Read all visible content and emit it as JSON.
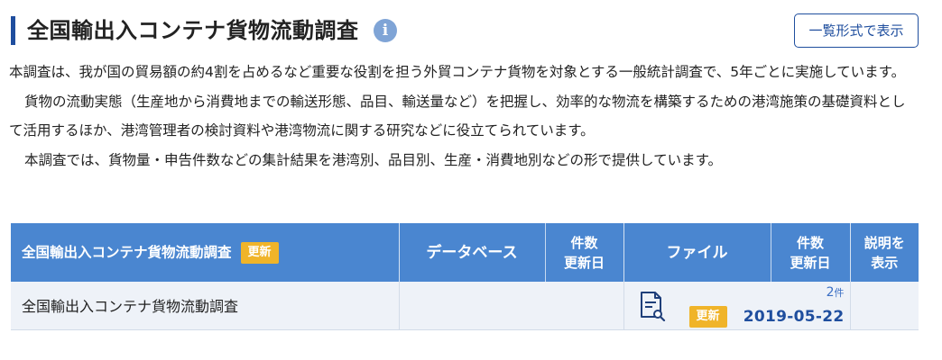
{
  "header": {
    "title": "全国輸出入コンテナ貨物流動調査",
    "info_icon": "info-icon",
    "list_button_label": "一覧形式で表示"
  },
  "description": {
    "paragraph1": "本調査は、我が国の貿易額の約4割を占めるなど重要な役割を担う外貿コンテナ貨物を対象とする一般統計調査で、5年ごとに実施しています。",
    "paragraph2": "貨物の流動実態（生産地から消費地までの輸送形態、品目、輸送量など）を把握し、効率的な物流を構築するための港湾施策の基礎資料として活用するほか、港湾管理者の検討資料や港湾物流に関する研究などに役立てられています。",
    "paragraph3": "本調査では、貨物量・申告件数などの集計結果を港湾別、品目別、生産・消費地別などの形で提供しています。"
  },
  "table": {
    "headers": {
      "name": "全国輸出入コンテナ貨物流動調査",
      "name_badge": "更新",
      "database": "データベース",
      "db_count_line1": "件数",
      "db_count_line2": "更新日",
      "file": "ファイル",
      "file_count_line1": "件数",
      "file_count_line2": "更新日",
      "desc_line1": "説明を",
      "desc_line2": "表示"
    },
    "rows": [
      {
        "name": "全国輸出入コンテナ貨物流動調査",
        "database": "",
        "file_icon": "document-search-icon",
        "file_count": "2",
        "file_count_unit": "件",
        "file_badge": "更新",
        "file_date": "2019-05-22"
      }
    ]
  },
  "colors": {
    "accent_blue": "#1f4e9e",
    "header_bg": "#4a86d0",
    "badge_yellow": "#f0b429",
    "row_bg": "#eef2f8"
  }
}
